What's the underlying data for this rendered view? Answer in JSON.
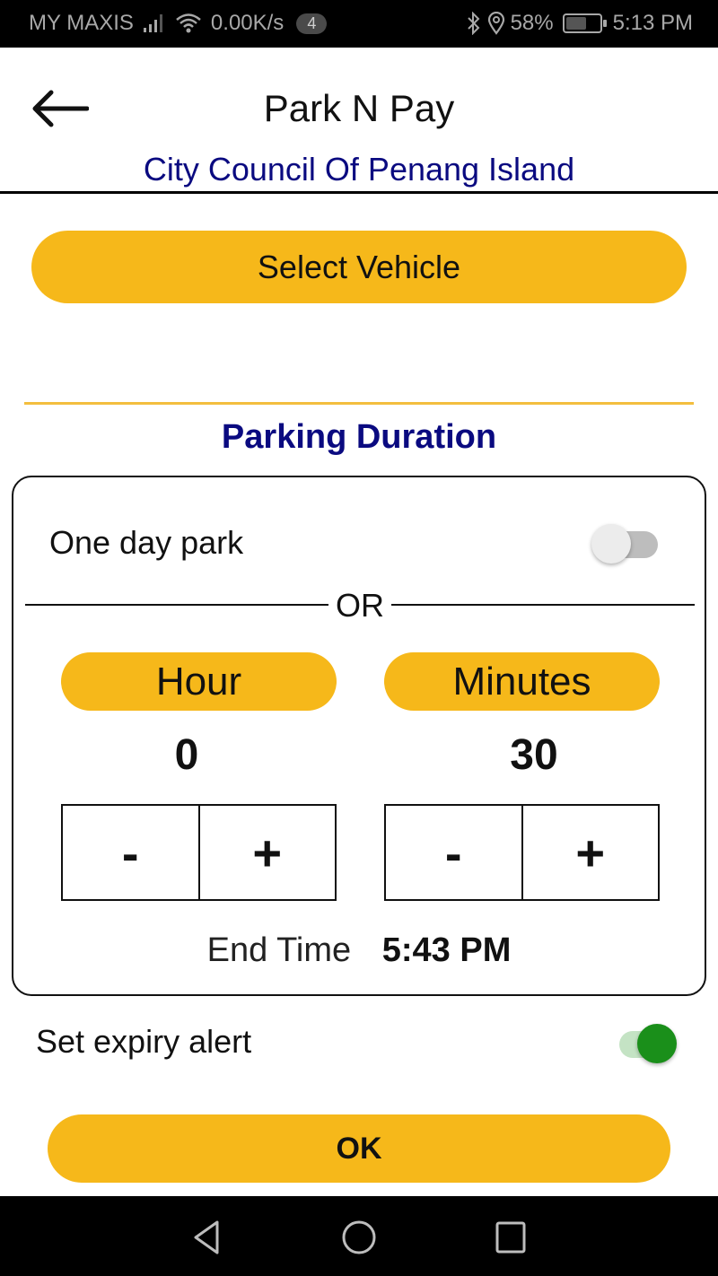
{
  "status_bar": {
    "carrier": "MY MAXIS",
    "net_speed": "0.00K/s",
    "notification_count": "4",
    "battery_percent": "58%",
    "time": "5:13 PM",
    "icons": [
      "signal-icon",
      "wifi-icon",
      "bluetooth-icon",
      "location-icon",
      "battery-icon"
    ]
  },
  "header": {
    "back_icon": "arrow-left-icon",
    "title": "Park N Pay",
    "subtitle": "City Council Of Penang Island"
  },
  "vehicle": {
    "select_label": "Select Vehicle"
  },
  "duration": {
    "section_title": "Parking Duration",
    "one_day_label": "One day park",
    "one_day_enabled": false,
    "or_label": "OR",
    "hour": {
      "label": "Hour",
      "value": "0",
      "decrement_label": "-",
      "increment_label": "+"
    },
    "minutes": {
      "label": "Minutes",
      "value": "30",
      "decrement_label": "-",
      "increment_label": "+"
    },
    "end_time_label": "End Time",
    "end_time_value": "5:43 PM"
  },
  "expiry_alert": {
    "label": "Set expiry alert",
    "enabled": true
  },
  "ok_label": "OK",
  "nav_bar": {
    "icons": [
      "nav-back-icon",
      "nav-home-icon",
      "nav-recents-icon"
    ]
  },
  "colors": {
    "accent_yellow": "#f6b81a",
    "title_navy": "#0a0a80",
    "toggle_on_green": "#1a8f1a",
    "divider_gold": "#f3be3e"
  }
}
